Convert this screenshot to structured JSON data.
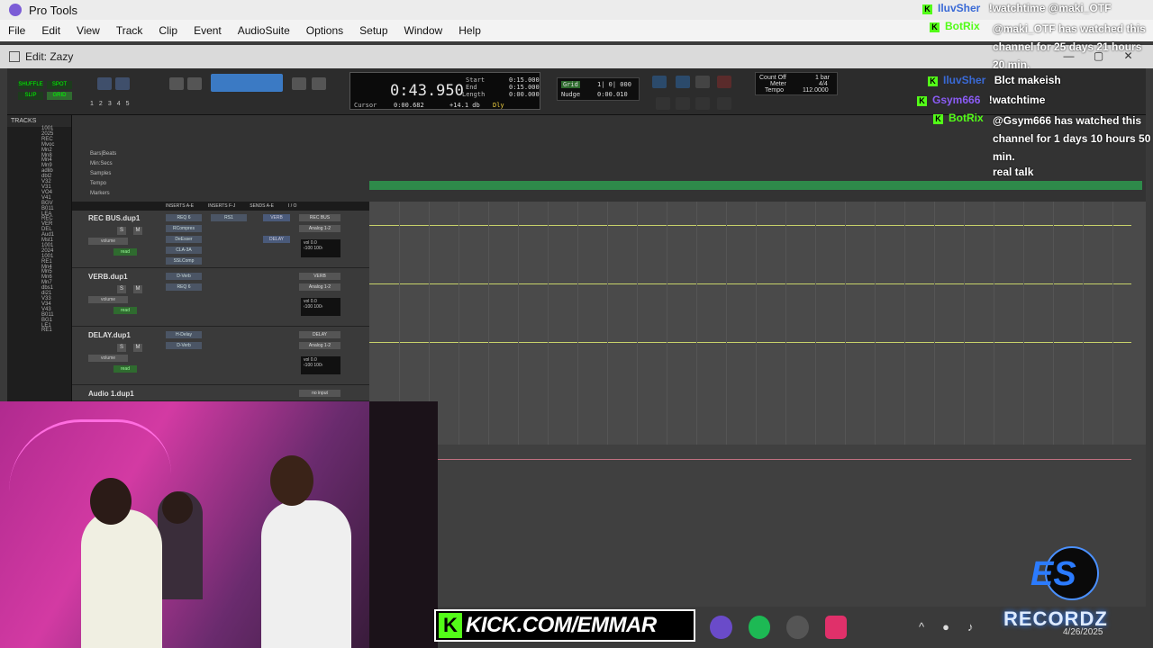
{
  "app": {
    "title": "Pro Tools"
  },
  "menu": [
    "File",
    "Edit",
    "View",
    "Track",
    "Clip",
    "Event",
    "AudioSuite",
    "Options",
    "Setup",
    "Window",
    "Help"
  ],
  "edit_window": {
    "title": "Edit: Zazy"
  },
  "modes": {
    "shuffle": "SHUFFLE",
    "spot": "SPOT",
    "slip": "SLIP",
    "grid": "GRID"
  },
  "zoom_presets": [
    "1",
    "2",
    "3",
    "4",
    "5"
  ],
  "counter": {
    "main": "0:43.950",
    "start_label": "Start",
    "start": "0:15.000",
    "end_label": "End",
    "end": "0:15.000",
    "length_label": "Length",
    "length": "0:00.000",
    "cursor_label": "Cursor",
    "cursor": "0:00.682",
    "db": "+14.1 db",
    "dly": "Dly"
  },
  "grid": {
    "label": "Grid",
    "grid_value": "1| 0| 000",
    "nudge_label": "Nudge",
    "nudge_value": "0:00.010"
  },
  "meter": {
    "count_off": "Count Off",
    "meter_label": "Meter",
    "tempo_label": "Tempo",
    "bar": "1 bar",
    "sig": "4/4",
    "tempo": "112.0000"
  },
  "tracks_panel": {
    "header": "TRACKS",
    "items": [
      "1001",
      "2025",
      "REC",
      "Mvoc",
      "Mn2",
      "Mn8",
      "Mn4",
      "Mn9",
      "adlib",
      "dbl2",
      "V32",
      "V31",
      "VO4",
      "V41",
      "BGV",
      "B011",
      "LEA",
      "REC",
      "VER",
      "DEL",
      "Aud1",
      "Mst1",
      "1001",
      "2024",
      "1001",
      "RE1",
      "Mn4",
      "Mn5",
      "Mn6",
      "Mn7",
      "dbs1",
      "di21",
      "V33",
      "V34",
      "V43",
      "B011",
      "BG1",
      "LE1",
      "RE1"
    ]
  },
  "ruler": {
    "bars_beats": "Bars|Beats",
    "min_secs": "Min:Secs",
    "samples": "Samples",
    "tempo": "Tempo",
    "markers": "Markers"
  },
  "mix_header": [
    "INSERTS A-E",
    "INSERTS F-J",
    "SENDS A-E",
    "I / O"
  ],
  "tracks": [
    {
      "name": "REC BUS.dup1",
      "inserts": [
        "REQ 6",
        "RCompres",
        "DeEsser",
        "CLA-3A",
        "SSLComp"
      ],
      "inserts_fj": [
        "RS1"
      ],
      "sends": [
        "VERB",
        "DELAY"
      ],
      "io_in": "REC BUS",
      "io_out": "Analog 1-2",
      "vol": "0.0",
      "pan_l": "100",
      "pan_r": "100",
      "mode": "volume",
      "view": "read"
    },
    {
      "name": "VERB.dup1",
      "inserts": [
        "D-Verb",
        "REQ 6"
      ],
      "inserts_fj": [],
      "sends": [],
      "io_in": "VERB",
      "io_out": "Analog 1-2",
      "vol": "0.0",
      "pan_l": "100",
      "pan_r": "100",
      "mode": "volume",
      "view": "read"
    },
    {
      "name": "DELAY.dup1",
      "inserts": [
        "H-Delay",
        "D-Verb"
      ],
      "inserts_fj": [],
      "sends": [],
      "io_in": "DELAY",
      "io_out": "Analog 1-2",
      "vol": "0.0",
      "pan_l": "100",
      "pan_r": "100",
      "mode": "volume",
      "view": "read"
    },
    {
      "name": "Audio 1.dup1",
      "inserts": [],
      "inserts_fj": [],
      "sends": [],
      "io_in": "no input",
      "io_out": "",
      "vol": "",
      "pan_l": "",
      "pan_r": "",
      "mode": "",
      "view": ""
    }
  ],
  "chat": [
    {
      "user": "IluvSher",
      "user_color": "#3a6ad6",
      "msg": "!watchtime @maki_OTF"
    },
    {
      "user": "BotRix",
      "user_color": "#53fc18",
      "msg": "@maki_OTF has watched this channel for 25 days 21 hours 20 min."
    },
    {
      "user": "IluvSher",
      "user_color": "#3a6ad6",
      "msg": "Blct makeish"
    },
    {
      "user": "Gsym666",
      "user_color": "#8b5cf6",
      "msg": "!watchtime"
    },
    {
      "user": "BotRix",
      "user_color": "#53fc18",
      "msg": "@Gsym666 has watched this channel for 1 days 10 hours 50 min."
    },
    {
      "user": "",
      "user_color": "#ffffff",
      "msg": "real talk"
    }
  ],
  "stream_overlay": {
    "kick_url": "KICK.COM/EMMAR",
    "brand": "RECORDZ",
    "brand_mark": "ES"
  },
  "taskbar": {
    "date": "4/26/2025"
  },
  "colors": {
    "kick_green": "#53fc18",
    "tempo_green": "#2e8a4a",
    "automation_line": "#c8d26a"
  }
}
